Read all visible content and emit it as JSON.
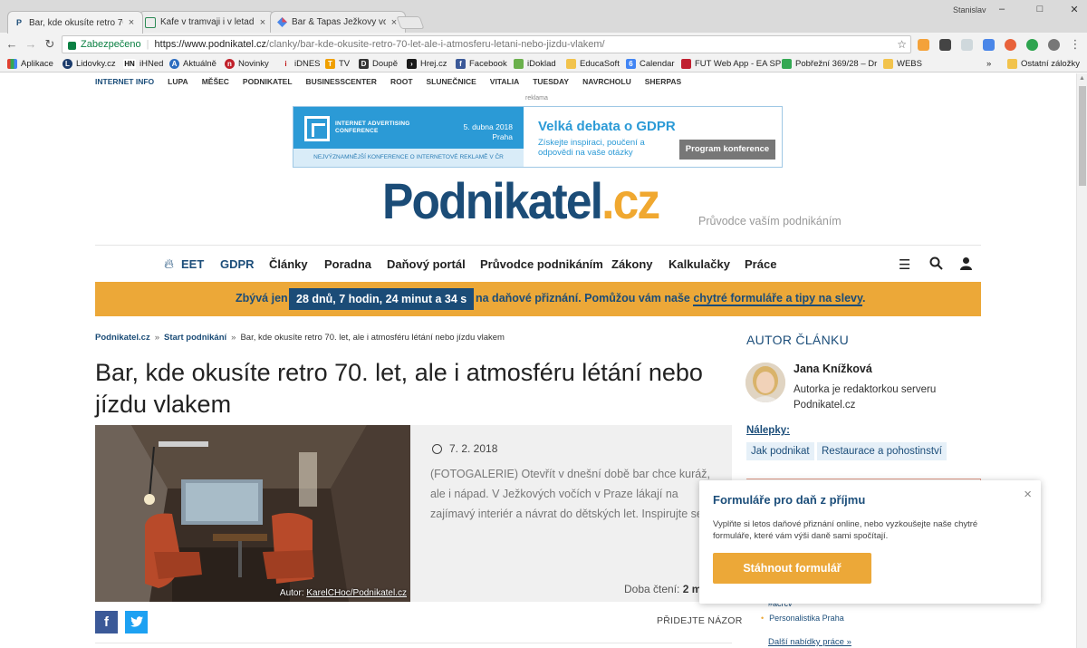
{
  "browser": {
    "user": "Stanislav",
    "tabs": [
      {
        "label": "Bar, kde okusíte retro 70.",
        "icon": "podnikatel-favicon"
      },
      {
        "label": "Kafe v tramvaji i v letadle",
        "icon": "sheet-favicon"
      },
      {
        "label": "Bar & Tapas Ježkovy voči",
        "icon": "diamond-favicon"
      }
    ],
    "secure_label": "Zabezpečeno",
    "url_host": "https://www.podnikatel.cz",
    "url_path": "/clanky/bar-kde-okusite-retro-70-let-ale-i-atmosferu-letani-nebo-jizdu-vlakem/",
    "bookmarks": [
      {
        "label": "Aplikace",
        "color": "#e04030"
      },
      {
        "label": "Lidovky.cz",
        "color": "#1c3c6c"
      },
      {
        "label": "iHNed",
        "color": "#111111"
      },
      {
        "label": "Aktuálně",
        "color": "#2a6cc0"
      },
      {
        "label": "Novinky",
        "color": "#c0202a"
      },
      {
        "label": "iDNES",
        "color": "#c01010"
      },
      {
        "label": "TV",
        "color": "#f0a000"
      },
      {
        "label": "Doupě",
        "color": "#333333"
      },
      {
        "label": "Hrej.cz",
        "color": "#1a1a1a"
      },
      {
        "label": "Facebook",
        "color": "#3b5998"
      },
      {
        "label": "iDoklad",
        "color": "#6ab04c"
      },
      {
        "label": "EducaSoft",
        "color": "#f2c34c"
      },
      {
        "label": "Calendar",
        "color": "#4285f4"
      },
      {
        "label": "FUT Web App - EA SP",
        "color": "#c02030"
      },
      {
        "label": "Pobřežní 369/28 – Dr",
        "color": "#34a853"
      },
      {
        "label": "WEBS",
        "color": "#f2c34c"
      }
    ],
    "bookmarks_more": "»",
    "other_bookmarks": "Ostatní záložky"
  },
  "site": {
    "topnav": [
      "INTERNET INFO",
      "LUPA",
      "MĚŠEC",
      "PODNIKATEL",
      "BUSINESSCENTER",
      "ROOT",
      "SLUNEČNICE",
      "VITALIA",
      "TUESDAY",
      "NAVRCHOLU",
      "SHERPAS"
    ],
    "ad": {
      "reklama": "reklama",
      "conference": "INTERNET ADVERTISING CONFERENCE",
      "date": "5. dubna 2018",
      "city": "Praha",
      "bottom": "NEJVÝZNAMNĚJŠÍ KONFERENCE O INTERNETOVÉ REKLAMĚ V ČR",
      "title": "Velká debata o GDPR",
      "sub": "Získejte inspiraci, poučení a odpovědi na vaše otázky",
      "button": "Program konference"
    },
    "logo_main": "Podnikatel",
    "logo_tld": ".cz",
    "tagline": "Průvodce vaším podnikáním",
    "mainnav": [
      "EET",
      "GDPR",
      "Články",
      "Poradna",
      "Daňový portál",
      "Průvodce podnikáním",
      "Zákony",
      "Kalkulačky",
      "Práce"
    ],
    "banner": {
      "pre": "Zbývá jen",
      "countdown": "28 dnů, 7 hodin, 24 minut a 34 s",
      "post": "na daňové přiznání. Pomůžou vám naše",
      "link": "chytré formuláře a tipy na slevy",
      "end": "."
    }
  },
  "article": {
    "crumbs": [
      "Podnikatel.cz",
      "Start podnikání",
      "Bar, kde okusíte retro 70. let, ale i atmosféru létání nebo jízdu vlakem"
    ],
    "crumb_sep": "»",
    "title": "Bar, kde okusíte retro 70. let, ale i atmosféru létání nebo jízdu vlakem",
    "photo_credit_prefix": "Autor: ",
    "photo_credit": "KarelCHoc/Podnikatel.cz",
    "date": "7. 2. 2018",
    "perex": "(FOTOGALERIE) Otevřít v dnešní době bar chce kuráž, ale i nápad. V Ježkových vočích v Praze lákají na zajímavý interiér a návrat do dětských let. Inspirujte se.",
    "reading_label": "Doba čtení:",
    "reading_value": "2 min",
    "follow": "PŘIDEJTE NÁZOR"
  },
  "sidebar": {
    "heading": "AUTOR ČLÁNKU",
    "author_name": "Jana Knížková",
    "author_desc": "Autorka je redaktorkou serveru Podnikatel.cz",
    "tags_label": "Nálepky:",
    "tags": [
      "Jak podnikat",
      "Restaurace a pohostinství"
    ],
    "job1": "#acrcv",
    "job2": "Personalistika Praha",
    "more_offers": "Další nabídky práce »"
  },
  "popup": {
    "title": "Formuláře pro daň z příjmu",
    "text": "Vyplňte si letos daňové přiznání online, nebo vyzkoušejte naše chytré formuláře, které vám výši daně sami spočítají.",
    "button": "Stáhnout formulář",
    "close": "×"
  },
  "colors": {
    "brand_blue": "#1b4c77",
    "brand_orange": "#eca838",
    "ad_blue": "#2b9ad6",
    "facebook": "#3b5998",
    "twitter": "#1da1f2"
  }
}
